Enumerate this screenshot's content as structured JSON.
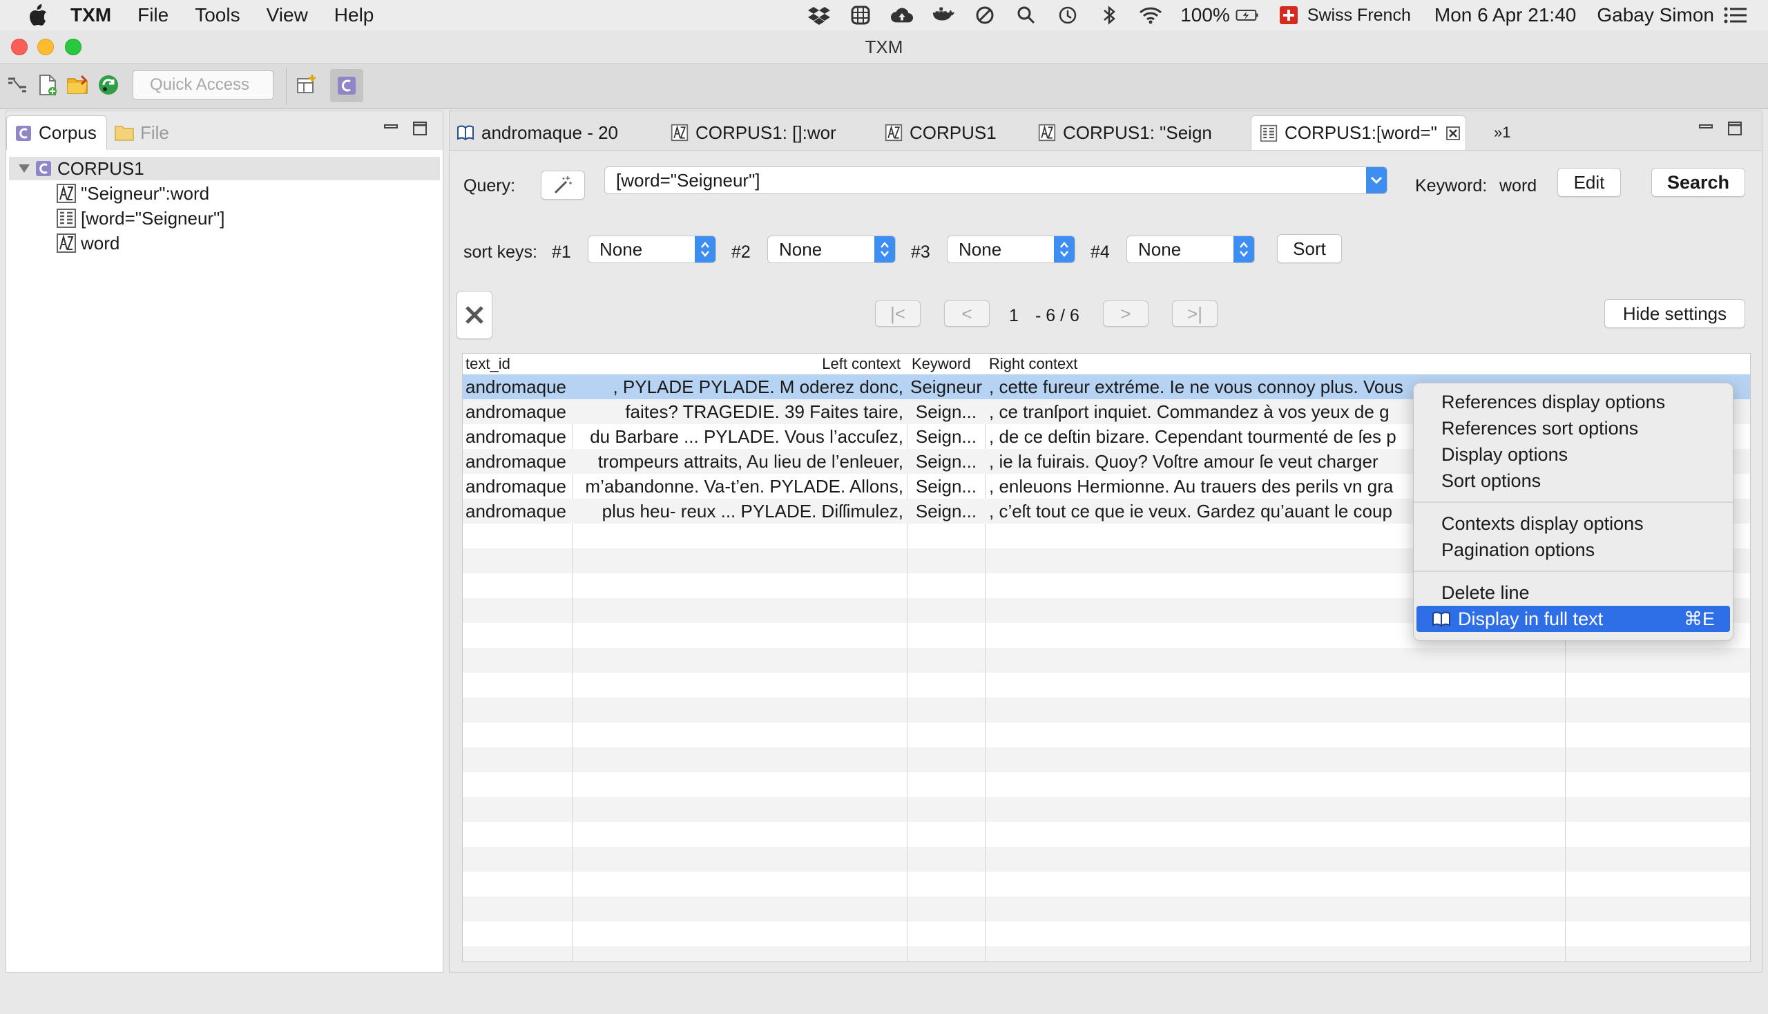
{
  "menubar": {
    "app": "TXM",
    "items": [
      "File",
      "Tools",
      "View",
      "Help"
    ],
    "battery": "100%",
    "input_source": "Swiss French",
    "datetime": "Mon 6 Apr  21:40",
    "user": "Gabay Simon"
  },
  "window": {
    "title": "TXM"
  },
  "toolbar": {
    "quick_access_placeholder": "Quick Access"
  },
  "left_panel": {
    "tabs": [
      "Corpus",
      "File"
    ],
    "tree": {
      "root": "CORPUS1",
      "children": [
        "\"Seigneur\":word",
        "[word=\"Seigneur\"]",
        "word"
      ]
    }
  },
  "editor": {
    "tabs": [
      "andromaque - 20",
      "CORPUS1: []:wor",
      "CORPUS1",
      "CORPUS1: \"Seign",
      "CORPUS1:[word=\""
    ],
    "overflow": "»1",
    "query_label": "Query:",
    "query_value": "[word=\"Seigneur\"]",
    "keyword_label": "Keyword:",
    "keyword_value": "word",
    "edit_label": "Edit",
    "search_label": "Search",
    "sort_keys_label": "sort keys:",
    "sort_keys": [
      {
        "num": "#1",
        "value": "None"
      },
      {
        "num": "#2",
        "value": "None"
      },
      {
        "num": "#3",
        "value": "None"
      },
      {
        "num": "#4",
        "value": "None"
      }
    ],
    "sort_label": "Sort",
    "pagination": {
      "first": "|<",
      "prev": "<",
      "page": "1",
      "range": "- 6 / 6",
      "next": ">",
      "last": ">|"
    },
    "hide_settings_label": "Hide settings",
    "table": {
      "headers": [
        "text_id",
        "Left context",
        "Keyword",
        "Right context"
      ],
      "rows": [
        {
          "text_id": "andromaque",
          "left": ", PYLADE PYLADE. M oderez donc,",
          "keyword": "Seigneur",
          "right": ", cette fureur extréme. Ie ne vous connoy plus. Vous"
        },
        {
          "text_id": "andromaque",
          "left": "faites? TRAGEDIE. 39 Faites taire,",
          "keyword": "Seign...",
          "right": ", ce tranſport inquiet. Commandez à vos yeux de g"
        },
        {
          "text_id": "andromaque",
          "left": "du Barbare ... PYLADE. Vous l’accuſez,",
          "keyword": "Seign...",
          "right": ", de ce deſtin bizare. Cependant tourmenté de ſes p"
        },
        {
          "text_id": "andromaque",
          "left": "trompeurs attraits, Au lieu de l’enleuer,",
          "keyword": "Seign...",
          "right": ", ie la fuirais. Quoy? Voſtre amour ſe veut charger"
        },
        {
          "text_id": "andromaque",
          "left": "m’abandonne. Va-t’en. PYLADE. Allons,",
          "keyword": "Seign...",
          "right": ", enleuons Hermionne. Au trauers des perils vn gra"
        },
        {
          "text_id": "andromaque",
          "left": "plus heu- reux ... PYLADE. Diſſimulez,",
          "keyword": "Seign...",
          "right": ", c’eſt tout ce que ie veux. Gardez qu’auant le coup"
        }
      ]
    }
  },
  "context_menu": {
    "group1": [
      "References display options",
      "References sort options",
      "Display options",
      "Sort options"
    ],
    "group2": [
      "Contexts display options",
      "Pagination options"
    ],
    "group3": [
      "Delete line"
    ],
    "highlighted": {
      "label": "Display in full text",
      "shortcut": "⌘E"
    }
  },
  "colors": {
    "selection": "#b7d3f3",
    "menu_highlight": "#2e6ee6",
    "select_arrow": "#3d8ef0",
    "stripe": "#f3f3f3"
  }
}
